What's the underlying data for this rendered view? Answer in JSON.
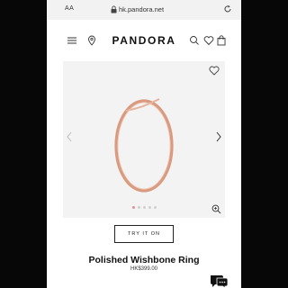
{
  "browser": {
    "text_size_label": "AA",
    "url": "hk.pandora.net"
  },
  "nav": {
    "logo": "PANDORA"
  },
  "product": {
    "image_dots": {
      "count": 5,
      "active_index": 0
    },
    "try_on_label": "TRY IT ON",
    "name": "Polished Wishbone Ring",
    "price": "HK$399.00"
  },
  "colors": {
    "ring": "#d99a80",
    "active_dot": "#e88a9b",
    "image_bg": "#f3f3f3",
    "frame": "#070707"
  },
  "icons": [
    "lock-icon",
    "reload-icon",
    "menu-icon",
    "location-icon",
    "search-icon",
    "heart-icon",
    "bag-icon",
    "wishlist-heart-icon",
    "chevron-left-icon",
    "chevron-right-icon",
    "zoom-icon",
    "chat-icon"
  ]
}
